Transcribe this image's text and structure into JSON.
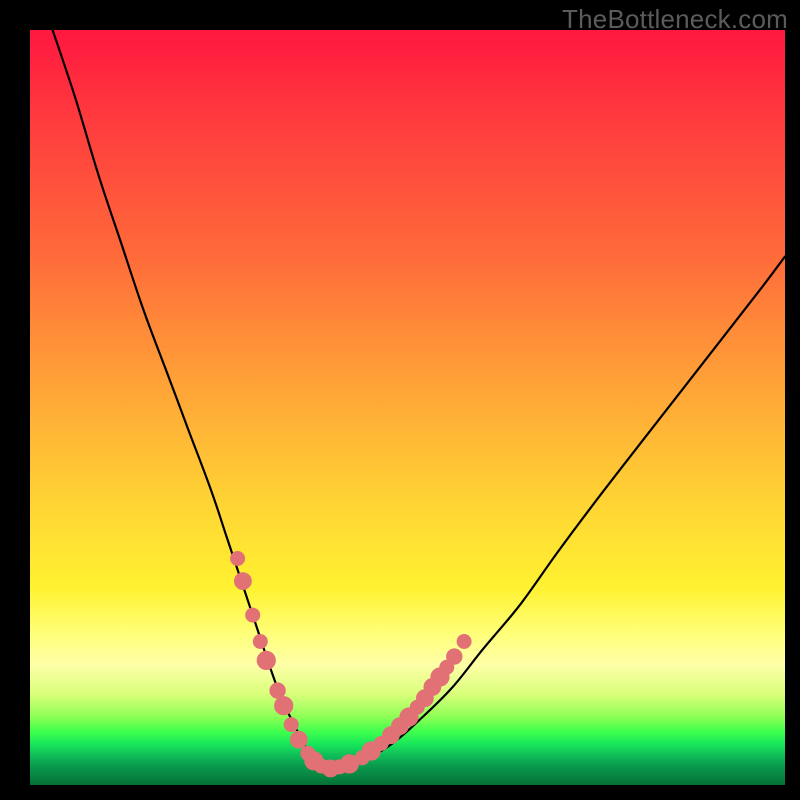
{
  "watermark": "TheBottleneck.com",
  "colors": {
    "gradient_top": "#ff173f",
    "gradient_mid": "#ffd833",
    "gradient_bottom": "#056e34",
    "curve": "#000000",
    "markers": "#e27176",
    "frame": "#000000"
  },
  "chart_data": {
    "type": "line",
    "title": "",
    "xlabel": "",
    "ylabel": "",
    "xlim": [
      0,
      100
    ],
    "ylim": [
      0,
      100
    ],
    "grid": false,
    "legend": false,
    "series": [
      {
        "name": "bottleneck-curve",
        "x": [
          3,
          6,
          9,
          12,
          15,
          18,
          21,
          24,
          26,
          28,
          30,
          32,
          33.5,
          35,
          36.5,
          38,
          39.5,
          41,
          44,
          48,
          52,
          56,
          60,
          65,
          70,
          76,
          83,
          90,
          97,
          100
        ],
        "y": [
          100,
          91,
          81,
          72,
          63,
          55,
          47,
          39,
          33,
          27,
          21,
          15,
          11,
          8,
          5,
          3,
          2.2,
          2.4,
          3.2,
          5.5,
          9,
          13,
          18,
          24,
          31,
          39,
          48,
          57,
          66,
          70
        ]
      }
    ],
    "markers": [
      {
        "name": "left-arm-markers",
        "points": [
          {
            "x": 27.5,
            "y": 30,
            "r": 1.0
          },
          {
            "x": 28.2,
            "y": 27,
            "r": 1.2
          },
          {
            "x": 29.5,
            "y": 22.5,
            "r": 1.0
          },
          {
            "x": 30.5,
            "y": 19,
            "r": 1.0
          },
          {
            "x": 31.3,
            "y": 16.5,
            "r": 1.3
          },
          {
            "x": 32.8,
            "y": 12.5,
            "r": 1.1
          },
          {
            "x": 33.6,
            "y": 10.5,
            "r": 1.3
          },
          {
            "x": 34.6,
            "y": 8,
            "r": 1.0
          },
          {
            "x": 35.6,
            "y": 6,
            "r": 1.2
          }
        ]
      },
      {
        "name": "valley-markers",
        "points": [
          {
            "x": 36.8,
            "y": 4.2,
            "r": 1.0
          },
          {
            "x": 37.6,
            "y": 3.2,
            "r": 1.3
          },
          {
            "x": 38.6,
            "y": 2.5,
            "r": 1.0
          },
          {
            "x": 39.8,
            "y": 2.2,
            "r": 1.2
          },
          {
            "x": 41.0,
            "y": 2.4,
            "r": 1.0
          },
          {
            "x": 42.3,
            "y": 2.8,
            "r": 1.3
          }
        ]
      },
      {
        "name": "right-arm-markers",
        "points": [
          {
            "x": 44.0,
            "y": 3.6,
            "r": 1.0
          },
          {
            "x": 45.2,
            "y": 4.5,
            "r": 1.3
          },
          {
            "x": 46.5,
            "y": 5.5,
            "r": 1.0
          },
          {
            "x": 47.8,
            "y": 6.6,
            "r": 1.2
          },
          {
            "x": 49.0,
            "y": 7.8,
            "r": 1.2
          },
          {
            "x": 50.2,
            "y": 9.0,
            "r": 1.3
          },
          {
            "x": 51.3,
            "y": 10.3,
            "r": 1.0
          },
          {
            "x": 52.3,
            "y": 11.5,
            "r": 1.2
          },
          {
            "x": 53.3,
            "y": 13.0,
            "r": 1.2
          },
          {
            "x": 54.3,
            "y": 14.3,
            "r": 1.3
          },
          {
            "x": 55.2,
            "y": 15.6,
            "r": 1.0
          },
          {
            "x": 56.2,
            "y": 17.0,
            "r": 1.1
          },
          {
            "x": 57.5,
            "y": 19.0,
            "r": 1.0
          }
        ]
      }
    ]
  }
}
